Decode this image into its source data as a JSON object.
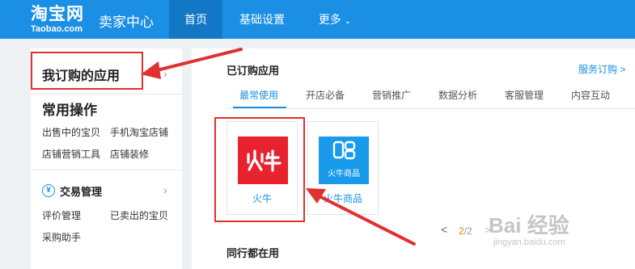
{
  "header": {
    "logo_cn": "淘宝网",
    "logo_en": "Taobao.com",
    "center_title": "卖家中心",
    "nav": [
      {
        "label": "首页"
      },
      {
        "label": "基础设置"
      },
      {
        "label": "更多"
      }
    ]
  },
  "sidebar": {
    "my_apps": "我订购的应用",
    "common_ops_title": "常用操作",
    "common_links": [
      "出售中的宝贝",
      "手机淘宝店铺",
      "店铺营销工具",
      "店铺装修"
    ],
    "trade_icon": "¥",
    "trade_title": "交易管理",
    "trade_links": [
      "评价管理",
      "已卖出的宝贝",
      "采购助手"
    ]
  },
  "main": {
    "purchased_title": "已订购应用",
    "service_link": "服务订购 >",
    "tabs": [
      "最常使用",
      "开店必备",
      "营销推广",
      "数据分析",
      "客服管理",
      "内容互动"
    ],
    "apps": [
      {
        "name": "火牛",
        "icon_text": "火牛",
        "icon": "huoniu-icon"
      },
      {
        "name": "火牛商品",
        "icon_text": "火牛商品",
        "icon": "huoniu-goods-icon"
      }
    ],
    "pager": {
      "prev": "<",
      "current": "2",
      "sep": "/",
      "total": "2",
      "next": ">"
    },
    "peers_title": "同行都在用"
  },
  "colors": {
    "brand_blue": "#1a8fe3",
    "nav_active": "#1277c4",
    "app_red": "#e8222e",
    "app_blue": "#1a9aeb",
    "annotation_red": "#e03030"
  },
  "watermark": {
    "main": "Bai 经验",
    "sub": "jingyan.baidu.com"
  }
}
